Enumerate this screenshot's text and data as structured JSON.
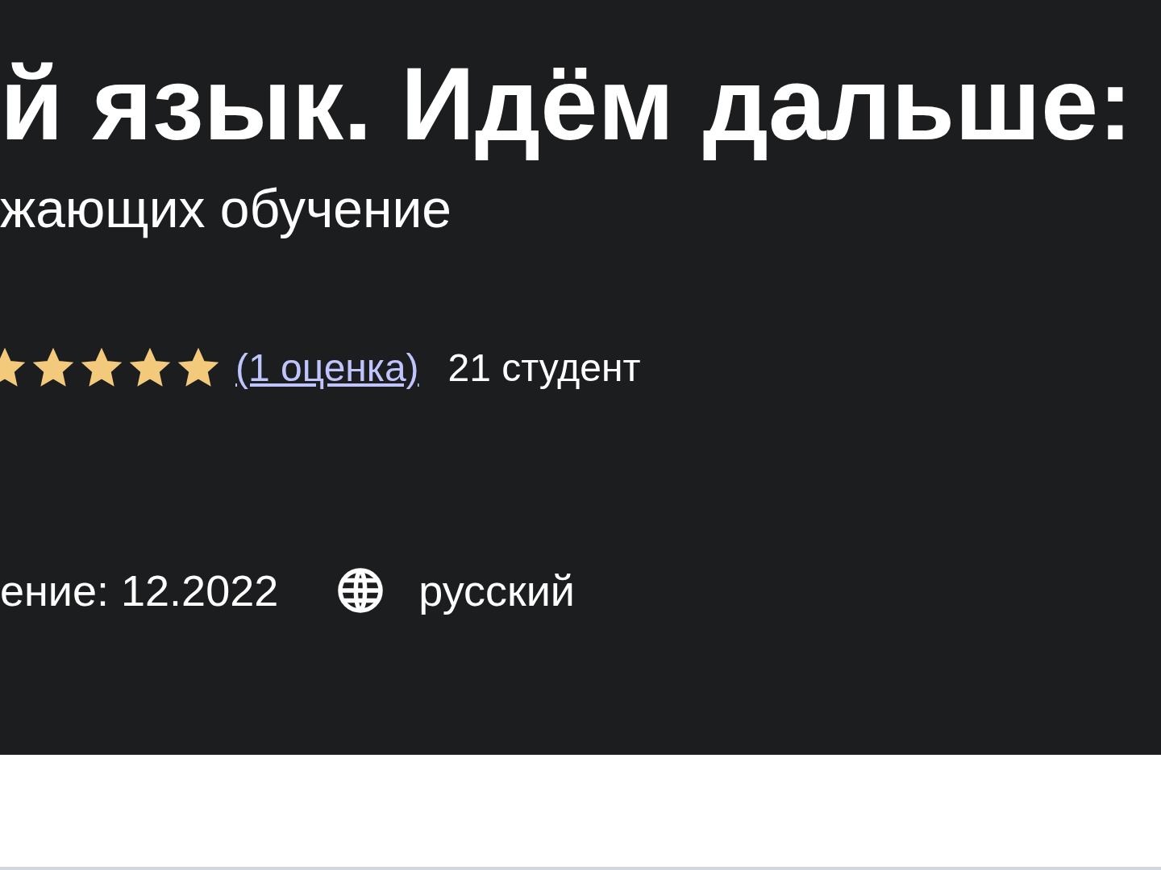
{
  "course": {
    "title": "й язык. Идём дальше:",
    "subtitle": "жающих обучение",
    "rating": {
      "stars": 5,
      "count_link": "(1 оценка)",
      "students": "21 студент"
    },
    "updated": "ение: 12.2022",
    "language": "русский"
  }
}
